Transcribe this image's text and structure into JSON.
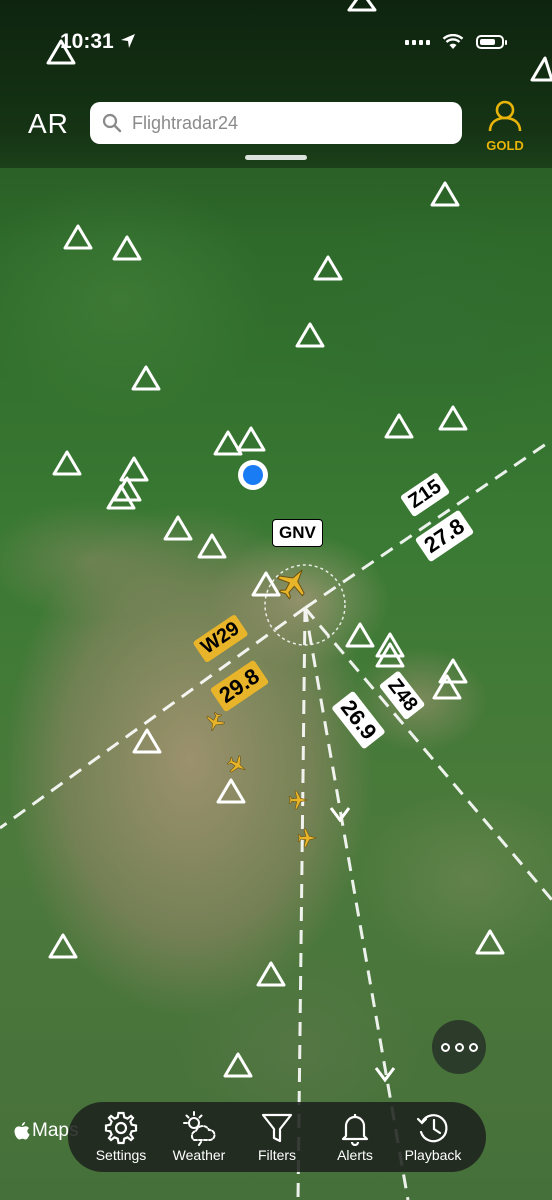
{
  "status_bar": {
    "time": "10:31",
    "battery_level": 0.75
  },
  "header": {
    "ar_label": "AR",
    "search_placeholder": "Flightradar24",
    "gold_label": "GOLD"
  },
  "map": {
    "airport_code": "GNV",
    "runway_labels": [
      {
        "id": "z15",
        "text": "Z15",
        "style": "white"
      },
      {
        "id": "r278",
        "text": "27.8",
        "style": "white"
      },
      {
        "id": "w29",
        "text": "W29",
        "style": "yellow"
      },
      {
        "id": "r298",
        "text": "29.8",
        "style": "yellow"
      },
      {
        "id": "z48",
        "text": "Z48",
        "style": "white"
      },
      {
        "id": "r269",
        "text": "26.9",
        "style": "white"
      }
    ],
    "attribution": "Maps"
  },
  "tab_bar": {
    "items": [
      {
        "label": "Settings",
        "icon": "gear-icon"
      },
      {
        "label": "Weather",
        "icon": "weather-icon"
      },
      {
        "label": "Filters",
        "icon": "filter-icon"
      },
      {
        "label": "Alerts",
        "icon": "bell-icon"
      },
      {
        "label": "Playback",
        "icon": "playback-icon"
      }
    ]
  },
  "colors": {
    "accent_gold": "#e8b40a",
    "aircraft_yellow": "#e8b42a",
    "location_blue": "#1a7cf5"
  }
}
